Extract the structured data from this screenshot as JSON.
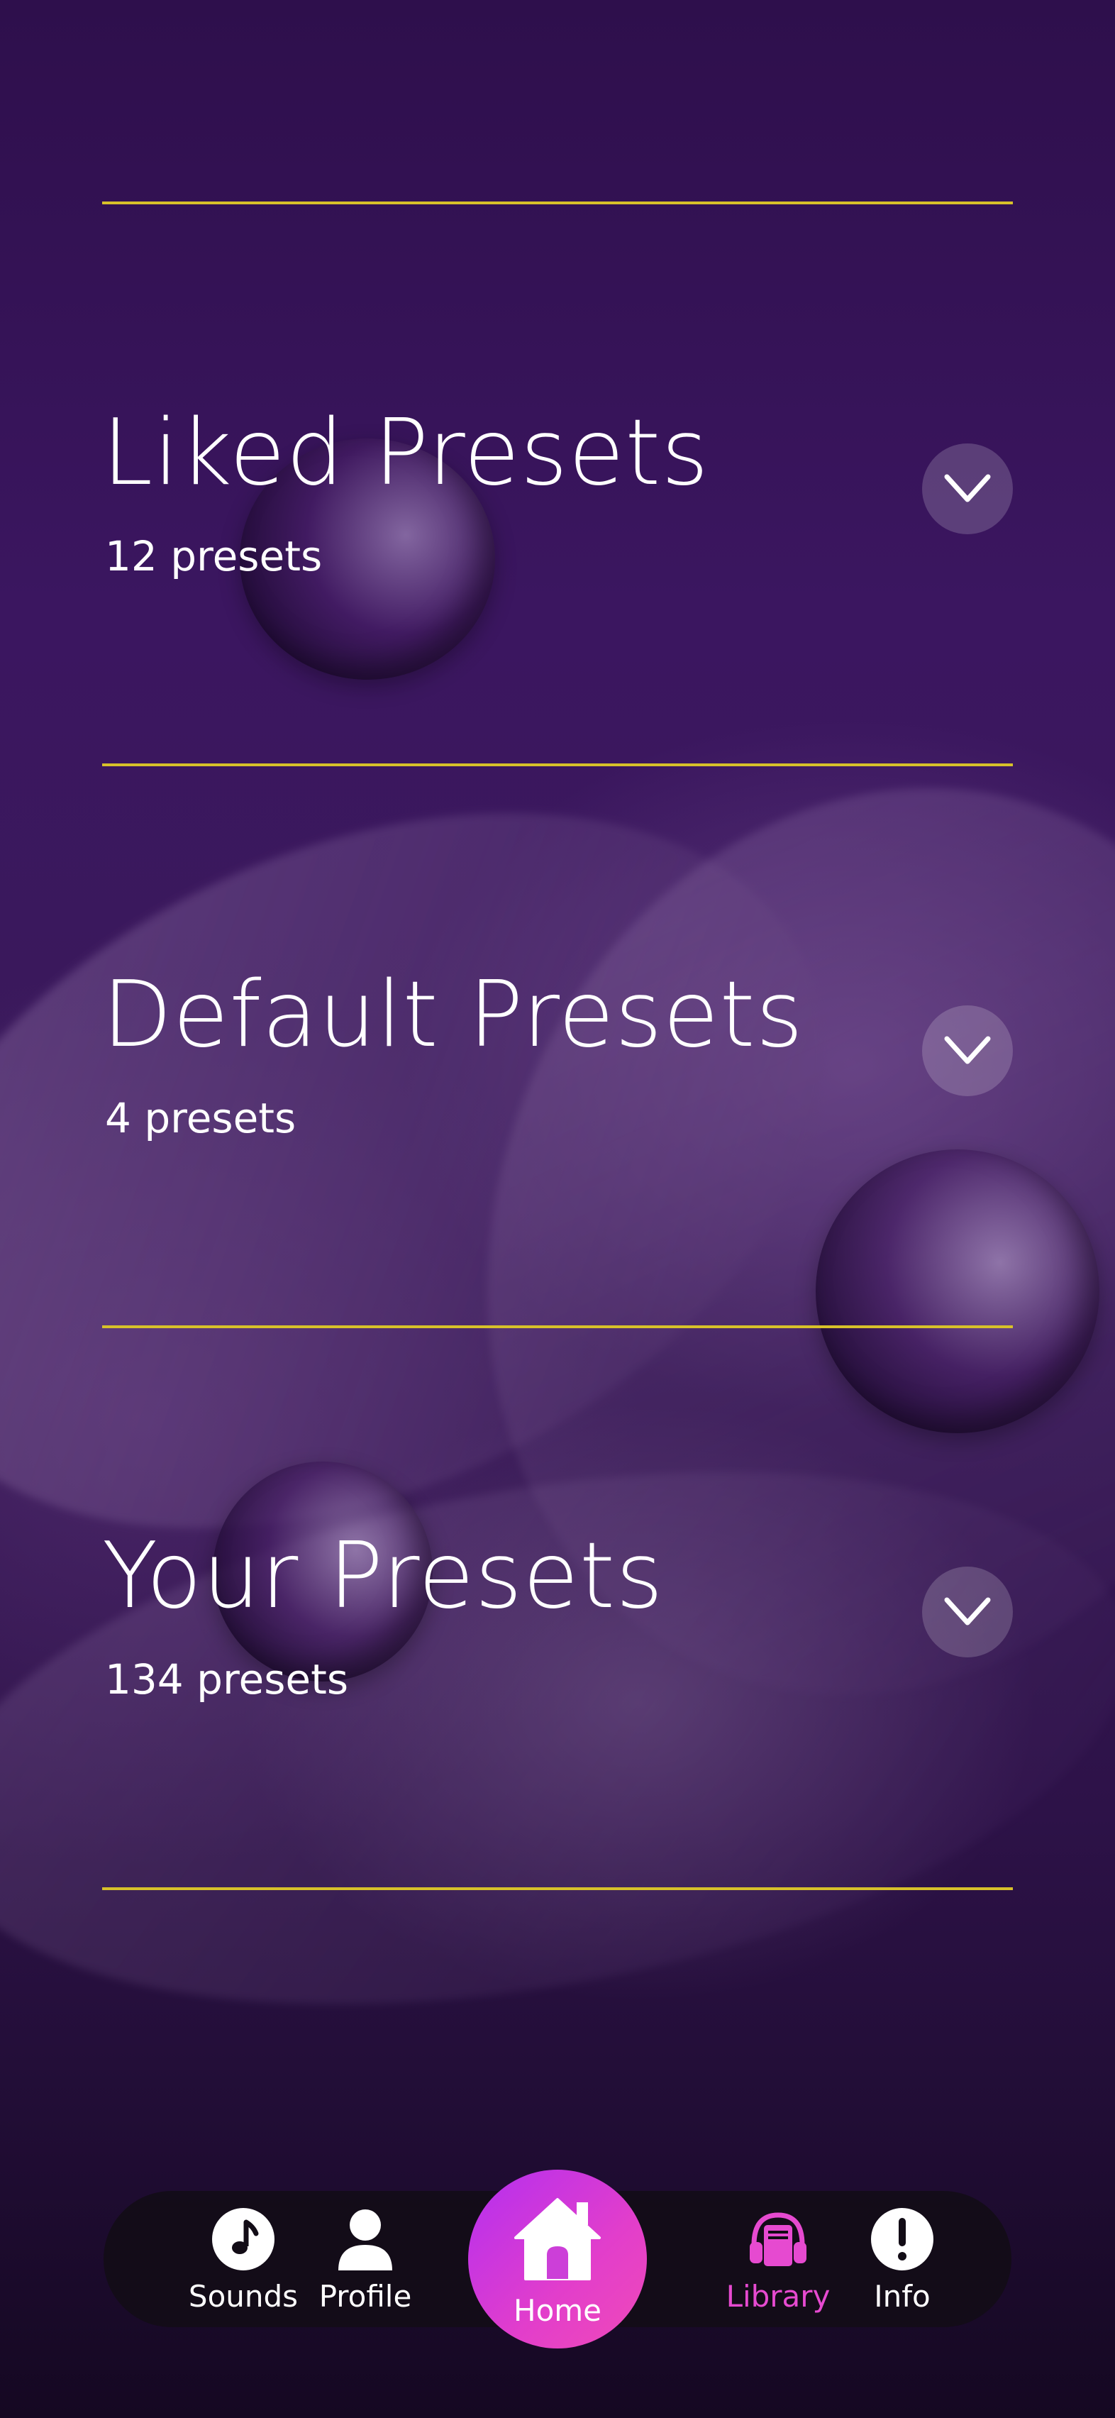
{
  "colors": {
    "accent_line": "#d7c12a",
    "active_nav": "#e64ad0",
    "home_gradient_start": "#b42ff0",
    "home_gradient_end": "#f04ab8",
    "nav_background": "#120c16"
  },
  "sections": [
    {
      "title": "Liked Presets",
      "count": "12 presets",
      "icon": "chevron-down-icon"
    },
    {
      "title": "Default Presets",
      "count": "4 presets",
      "icon": "chevron-down-icon"
    },
    {
      "title": "Your Presets",
      "count": "134 presets",
      "icon": "chevron-down-icon"
    }
  ],
  "nav": {
    "sounds": {
      "label": "Sounds",
      "icon": "music-note-icon"
    },
    "profile": {
      "label": "Profile",
      "icon": "person-icon"
    },
    "home": {
      "label": "Home",
      "icon": "house-icon"
    },
    "library": {
      "label": "Library",
      "icon": "headphones-book-icon",
      "active": true
    },
    "info": {
      "label": "Info",
      "icon": "exclamation-icon"
    }
  }
}
